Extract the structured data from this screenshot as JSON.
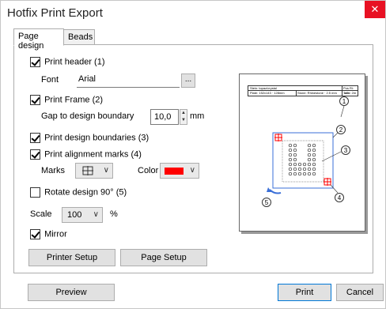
{
  "window": {
    "title": "Hotfix Print Export",
    "close": "✕"
  },
  "tabs": [
    {
      "label": "Page design",
      "active": true
    },
    {
      "label": "Beads",
      "active": false
    }
  ],
  "page_design": {
    "print_header": {
      "label": "Print header (1)",
      "checked": true
    },
    "font_label": "Font",
    "font_value": "Arial",
    "font_browse": "...",
    "print_frame": {
      "label": "Print Frame (2)",
      "checked": true
    },
    "gap_label": "Gap to design boundary",
    "gap_value": "10,0",
    "gap_unit": "mm",
    "print_boundaries": {
      "label": "Print design boundaries (3)",
      "checked": true
    },
    "print_alignment": {
      "label": "Print alignment marks (4)",
      "checked": true
    },
    "marks_label": "Marks",
    "marks_icon": "crosshair-square-icon",
    "color_label": "Color",
    "color_value": "#ff0000",
    "rotate": {
      "label": "Rotate design 90° (5)",
      "checked": false
    },
    "scale_label": "Scale",
    "scale_value": "100",
    "scale_unit": "%",
    "mirror": {
      "label": "Mirror",
      "checked": true
    },
    "printer_setup": "Printer Setup",
    "page_setup": "Page Setup"
  },
  "preview_image": {
    "callouts": [
      "1",
      "2",
      "3",
      "4",
      "5"
    ],
    "header_row1": [
      "Stein: topaz/crystal",
      "Pos Ri: 1x3"
    ],
    "header_row2": [
      "Plate: 152x143 · 128mm",
      "Stone: Rhinestone · 2.5 mm",
      "Total: 2m"
    ]
  },
  "footer": {
    "preview": "Preview",
    "print": "Print",
    "cancel": "Cancel"
  },
  "colors": {
    "accent": "#0078d7",
    "close_bg": "#e81123",
    "mark_red": "#ff0000",
    "frame_blue": "#3a6fd8"
  }
}
